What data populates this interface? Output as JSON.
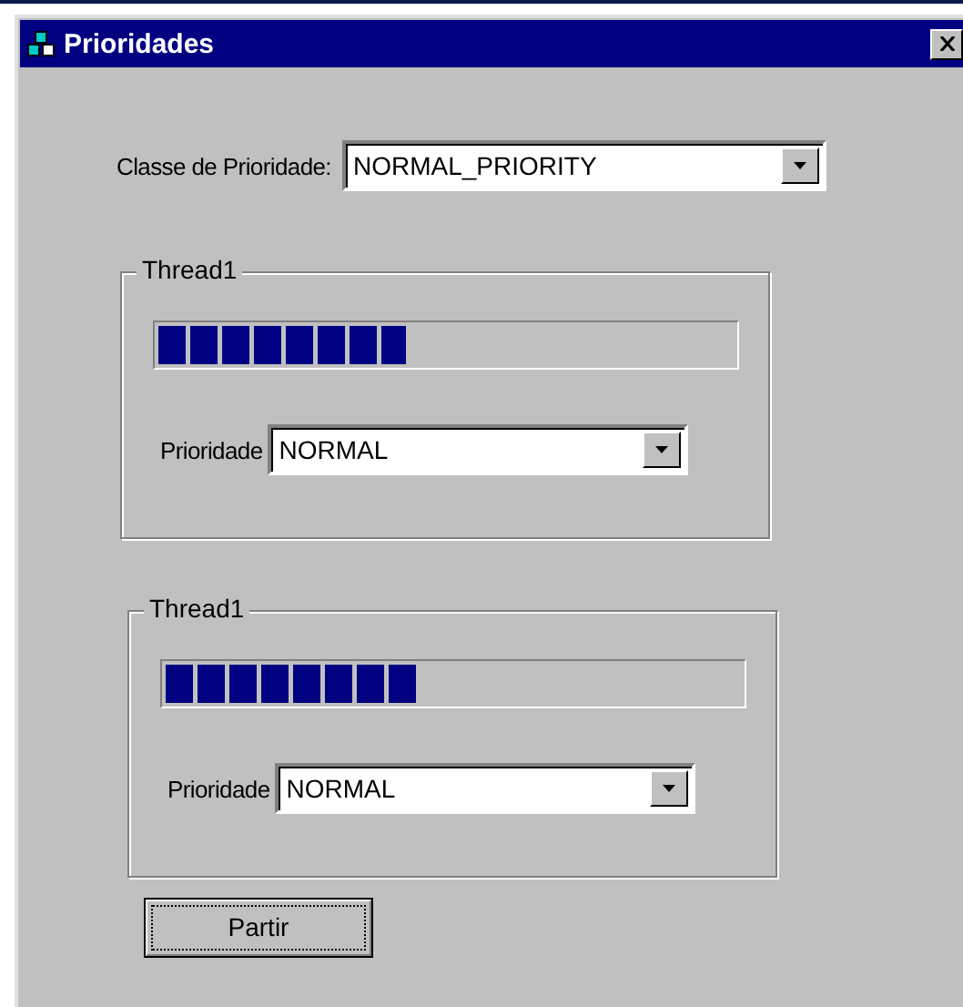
{
  "window": {
    "title": "Prioridades"
  },
  "priority_class": {
    "label": "Classe de Prioridade:",
    "value": "NORMAL_PRIORITY"
  },
  "threads": [
    {
      "title": "Thread1",
      "level": 0.43,
      "priority_label": "Prioridade",
      "priority": "NORMAL"
    },
    {
      "title": "Thread1",
      "level": 0.44,
      "priority_label": "Prioridade",
      "priority": "NORMAL"
    }
  ],
  "buttons": [
    {
      "label": "Partir",
      "focused": true
    }
  ]
}
